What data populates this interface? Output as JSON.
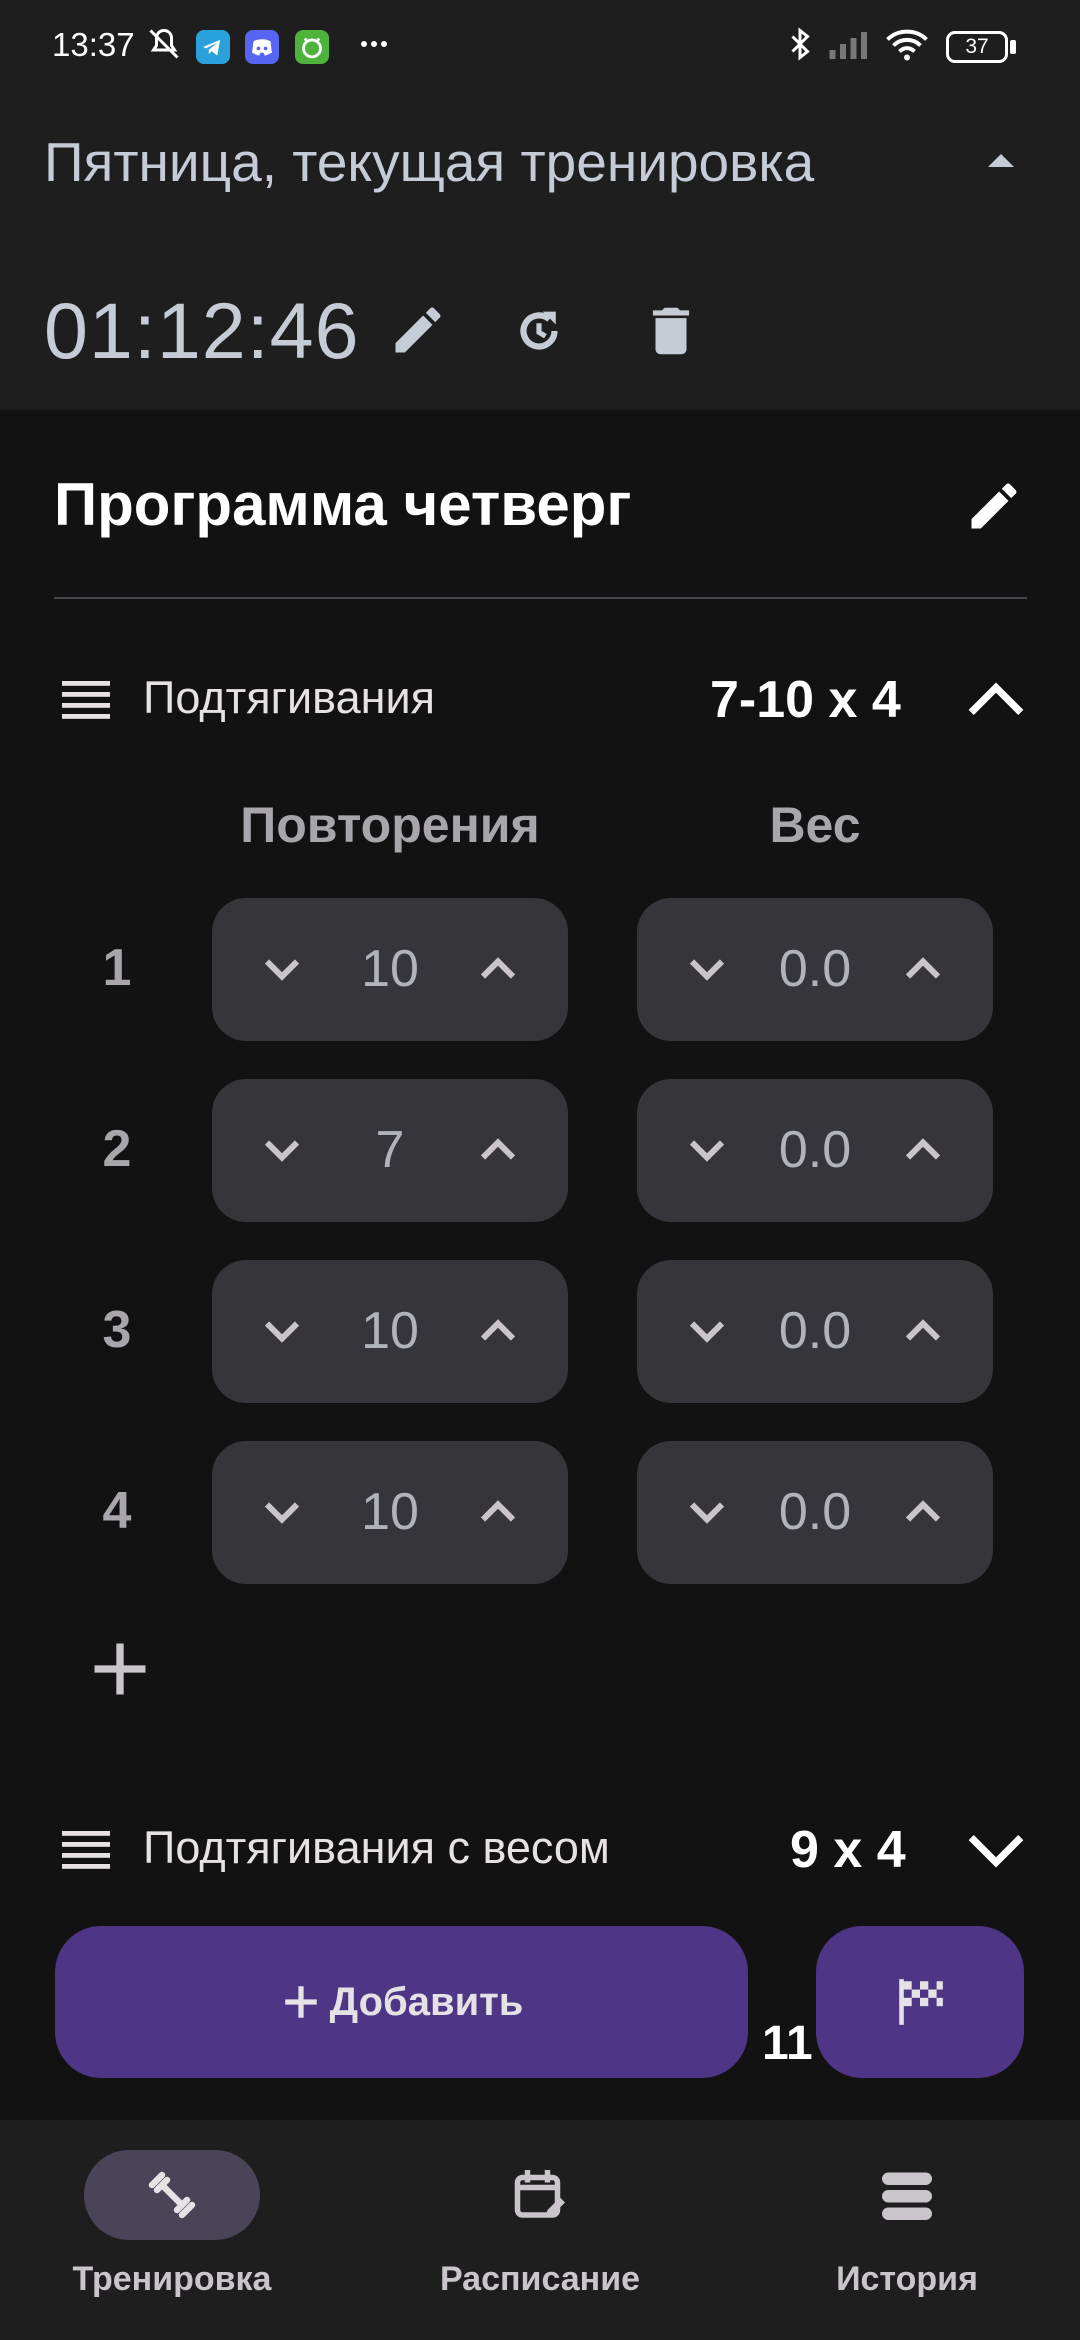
{
  "status_bar": {
    "time": "13:37",
    "battery": "37",
    "left_icons": [
      "bell-muted-icon",
      "telegram-icon",
      "discord-icon",
      "app-icon",
      "more-icon"
    ],
    "right_icons": [
      "bluetooth-icon",
      "cellular-icon",
      "wifi-icon",
      "battery-icon"
    ]
  },
  "header": {
    "title": "Пятница, текущая тренировка",
    "timer": "01:12:46",
    "actions": [
      "edit-icon",
      "restart-icon",
      "delete-icon"
    ]
  },
  "program": {
    "title": "Программа четверг"
  },
  "exercises": [
    {
      "name": "Подтягивания",
      "sets_summary": "7-10 x 4",
      "expanded": true,
      "columns": {
        "reps": "Повторения",
        "weight": "Вес"
      },
      "sets": [
        {
          "num": "1",
          "reps": "10",
          "weight": "0.0"
        },
        {
          "num": "2",
          "reps": "7",
          "weight": "0.0"
        },
        {
          "num": "3",
          "reps": "10",
          "weight": "0.0"
        },
        {
          "num": "4",
          "reps": "10",
          "weight": "0.0"
        }
      ]
    },
    {
      "name": "Подтягивания с весом",
      "sets_summary": "9 x 4",
      "expanded": false
    }
  ],
  "actions": {
    "add_label": "Добавить",
    "overlay_number": "11"
  },
  "nav": {
    "items": [
      {
        "label": "Тренировка",
        "icon": "dumbbell-icon",
        "active": true
      },
      {
        "label": "Расписание",
        "icon": "calendar-edit-icon",
        "active": false
      },
      {
        "label": "История",
        "icon": "history-list-icon",
        "active": false
      }
    ]
  },
  "colors": {
    "background": "#121212",
    "header": "#1e1e1e",
    "stepper": "#36353a",
    "accent_button": "#4e3585",
    "nav_active_pill": "#4a4458"
  }
}
